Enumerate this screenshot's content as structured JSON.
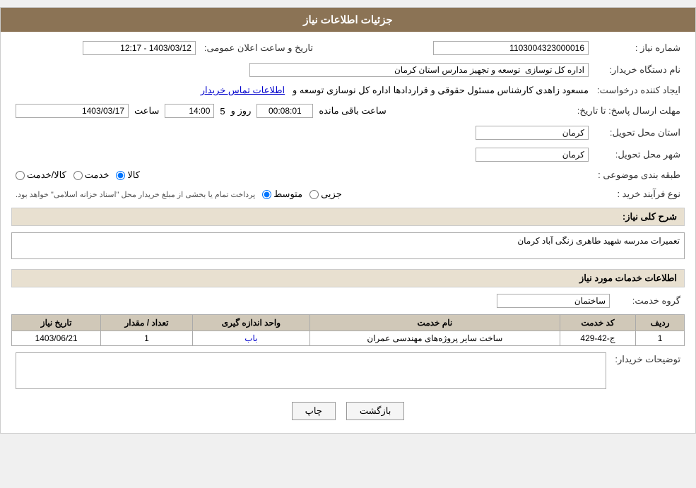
{
  "header": {
    "title": "جزئیات اطلاعات نیاز"
  },
  "fields": {
    "niyaz_number_label": "شماره نیاز :",
    "niyaz_number_value": "1103004323000016",
    "buyer_org_label": "نام دستگاه خریدار:",
    "buyer_org_value": "اداره کل توسازی  توسعه و تجهیز مدارس استان کرمان",
    "creator_label": "ایجاد کننده درخواست:",
    "creator_value": "مسعود زاهدی کارشناس مسئول حقوقی و قراردادها اداره کل نوسازی  توسعه و",
    "creator_link": "اطلاعات تماس خریدار",
    "deadline_label": "مهلت ارسال پاسخ: تا تاریخ:",
    "deadline_date": "1403/03/17",
    "deadline_time_label": "ساعت",
    "deadline_time": "14:00",
    "deadline_days_label": "روز و",
    "deadline_days": "5",
    "deadline_remaining_label": "ساعت باقی مانده",
    "deadline_remaining": "00:08:01",
    "province_label": "استان محل تحویل:",
    "province_value": "کرمان",
    "city_label": "شهر محل تحویل:",
    "city_value": "کرمان",
    "category_label": "طبقه بندی موضوعی :",
    "category_options": [
      "کالا",
      "خدمت",
      "کالا/خدمت"
    ],
    "category_selected": "کالا",
    "process_label": "نوع فرآیند خرید :",
    "process_options": [
      "جزیی",
      "متوسط"
    ],
    "process_selected": "متوسط",
    "process_note": "پرداخت تمام یا بخشی از مبلغ خریدار محل \"اسناد خزانه اسلامی\" خواهد بود.",
    "publish_label": "تاریخ و ساعت اعلان عمومی:",
    "publish_value": "1403/03/12 - 12:17",
    "description_label": "شرح کلی نیاز:",
    "description_value": "تعمیرات مدرسه شهید طاهری زنگی آباد کرمان",
    "services_section_title": "اطلاعات خدمات مورد نیاز",
    "service_group_label": "گروه خدمت:",
    "service_group_value": "ساختمان",
    "table": {
      "headers": [
        "ردیف",
        "کد خدمت",
        "نام خدمت",
        "واحد اندازه گیری",
        "تعداد / مقدار",
        "تاریخ نیاز"
      ],
      "rows": [
        {
          "row_num": "1",
          "service_code": "ج-42-429",
          "service_name": "ساخت سایر پروژه‌های مهندسی عمران",
          "unit": "باب",
          "quantity": "1",
          "date": "1403/06/21"
        }
      ]
    },
    "buyer_notes_label": "توضیحات خریدار:",
    "buyer_notes_value": ""
  },
  "buttons": {
    "back_label": "بازگشت",
    "print_label": "چاپ"
  }
}
